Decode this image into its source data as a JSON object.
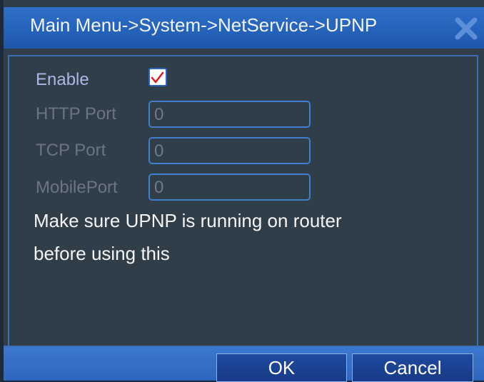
{
  "dialog": {
    "title": "Main Menu->System->NetService->UPNP",
    "close_icon": "close-icon"
  },
  "form": {
    "enable_label": "Enable",
    "enable_checked": true,
    "http_port_label": "HTTP Port",
    "http_port_value": "0",
    "tcp_port_label": "TCP Port",
    "tcp_port_value": "0",
    "mobile_port_label": "MobilePort",
    "mobile_port_value": "0"
  },
  "note": {
    "line1": "Make sure UPNP is running on router",
    "line2": "before using this"
  },
  "buttons": {
    "ok": "OK",
    "cancel": "Cancel"
  },
  "colors": {
    "title_bar": "#2563bb",
    "panel": "#303e4a",
    "checkmark": "#e0191f"
  }
}
